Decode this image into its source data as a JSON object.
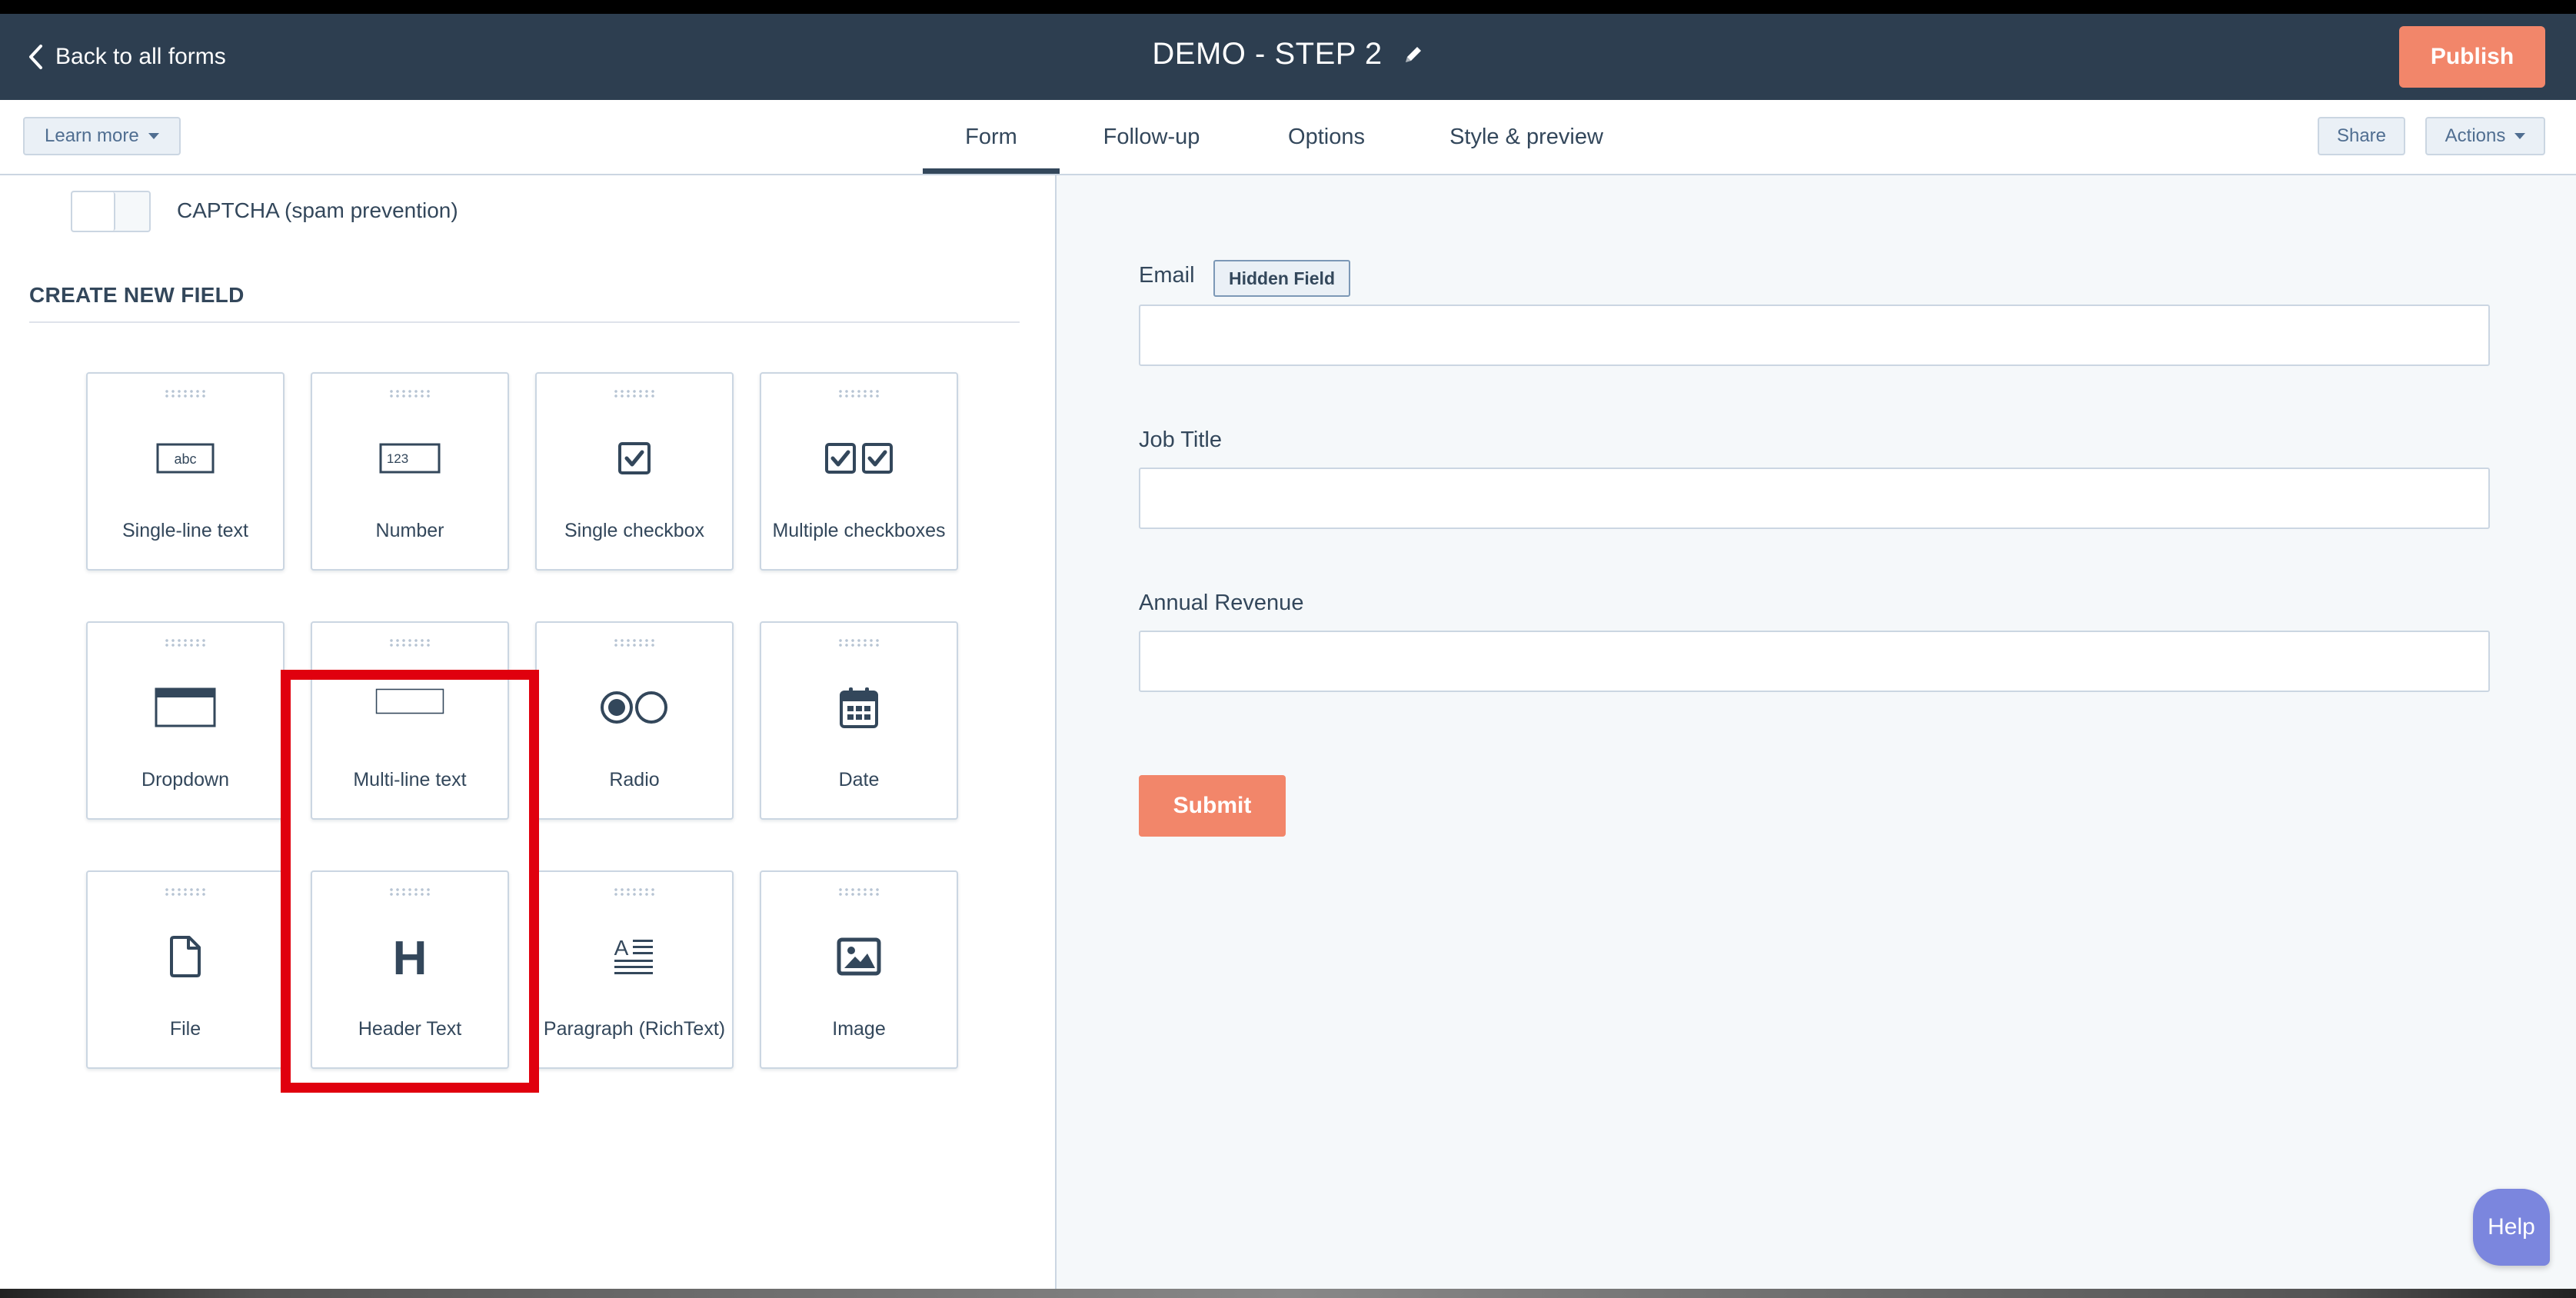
{
  "header": {
    "back_label": "Back to all forms",
    "title": "DEMO - STEP 2",
    "publish_label": "Publish"
  },
  "subnav": {
    "learn_more_label": "Learn more",
    "tabs": [
      {
        "label": "Form",
        "active": true
      },
      {
        "label": "Follow-up",
        "active": false
      },
      {
        "label": "Options",
        "active": false
      },
      {
        "label": "Style & preview",
        "active": false
      }
    ],
    "share_label": "Share",
    "actions_label": "Actions"
  },
  "left_panel": {
    "captcha_label": "CAPTCHA (spam prevention)",
    "captcha_enabled": false,
    "section_heading": "CREATE NEW FIELD",
    "field_types": [
      {
        "label": "Single-line text",
        "icon": "single-line-text-icon",
        "icon_text": "abc"
      },
      {
        "label": "Number",
        "icon": "number-icon",
        "icon_text": "123"
      },
      {
        "label": "Single checkbox",
        "icon": "checkbox-icon"
      },
      {
        "label": "Multiple checkboxes",
        "icon": "multiple-checkboxes-icon"
      },
      {
        "label": "Dropdown",
        "icon": "dropdown-icon"
      },
      {
        "label": "Multi-line text",
        "icon": "multi-line-text-icon"
      },
      {
        "label": "Radio",
        "icon": "radio-icon"
      },
      {
        "label": "Date",
        "icon": "calendar-icon"
      },
      {
        "label": "File",
        "icon": "file-icon"
      },
      {
        "label": "Header Text",
        "icon": "header-icon",
        "icon_text": "H",
        "highlighted": true
      },
      {
        "label": "Paragraph (RichText)",
        "icon": "paragraph-icon",
        "icon_text": "A"
      },
      {
        "label": "Image",
        "icon": "image-icon"
      }
    ]
  },
  "preview": {
    "fields": [
      {
        "label": "Email",
        "badge": "Hidden Field",
        "value": ""
      },
      {
        "label": "Job Title",
        "value": ""
      },
      {
        "label": "Annual Revenue",
        "value": ""
      }
    ],
    "submit_label": "Submit"
  },
  "help_label": "Help",
  "colors": {
    "header_bg": "#2d3e50",
    "accent": "#f2866a",
    "highlight": "#e0000e",
    "help": "#7b86de"
  }
}
